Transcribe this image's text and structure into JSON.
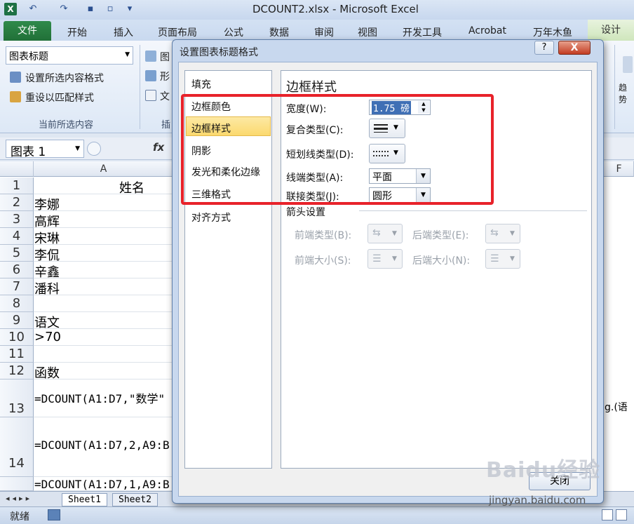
{
  "window": {
    "title": "DCOUNT2.xlsx  -  Microsoft Excel",
    "logo": "X"
  },
  "quick_access": [
    "↶",
    "↷",
    "▪",
    "▫",
    "▾"
  ],
  "tabs": {
    "file": "文件",
    "items": [
      "开始",
      "插入",
      "页面布局",
      "公式",
      "数据",
      "审阅",
      "视图",
      "开发工具",
      "Acrobat",
      "万年木鱼"
    ],
    "design": "设计"
  },
  "ribbon": {
    "combo_value": "图表标题",
    "format_selection": "设置所选内容格式",
    "reset_match": "重设以匹配样式",
    "group_label": "当前所选内容",
    "partial_items": [
      "图",
      "形",
      "文",
      "插"
    ],
    "right_partial": "趋势"
  },
  "formula_bar": {
    "name_box": "图表 1",
    "fx": "fx"
  },
  "grid": {
    "col_a": "A",
    "col_f": "F",
    "rows": [
      {
        "n": "1",
        "v": "姓名"
      },
      {
        "n": "2",
        "v": "李娜"
      },
      {
        "n": "3",
        "v": "高辉"
      },
      {
        "n": "4",
        "v": "宋琳"
      },
      {
        "n": "5",
        "v": "李侃"
      },
      {
        "n": "6",
        "v": "辛鑫"
      },
      {
        "n": "7",
        "v": "潘科"
      },
      {
        "n": "8",
        "v": ""
      },
      {
        "n": "9",
        "v": "语文"
      },
      {
        "n": "10",
        "v": ">70"
      },
      {
        "n": "11",
        "v": ""
      },
      {
        "n": "12",
        "v": "函数"
      },
      {
        "n": "13",
        "v": "=DCOUNT(A1:D7,\"数学\""
      },
      {
        "n": "14",
        "v": "=DCOUNT(A1:D7,2,A9:B"
      },
      {
        "n": "",
        "v": "=DCOUNT(A1:D7,1,A9:B"
      }
    ],
    "right_partial": "g.(语"
  },
  "sheets": [
    "Sheet1",
    "Sheet2"
  ],
  "status": {
    "ready": "就绪"
  },
  "dialog": {
    "title": "设置图表标题格式",
    "help": "?",
    "close": "X",
    "nav": [
      "填充",
      "边框颜色",
      "边框样式",
      "阴影",
      "发光和柔化边缘",
      "三维格式",
      "对齐方式"
    ],
    "selected_nav": "边框样式",
    "panel_title": "边框样式",
    "width_label": "宽度(W):",
    "width_value": "1.75 磅",
    "compound_label": "复合类型(C):",
    "dash_label": "短划线类型(D):",
    "cap_label": "线端类型(A):",
    "cap_value": "平面",
    "join_label": "联接类型(J):",
    "join_value": "圆形",
    "arrow_header": "箭头设置",
    "begin_type": "前端类型(B):",
    "end_type": "后端类型(E):",
    "begin_size": "前端大小(S):",
    "end_size": "后端大小(N):",
    "close_btn": "关闭"
  },
  "watermark": {
    "text": "Baidu经验",
    "url": "jingyan.baidu.com"
  }
}
